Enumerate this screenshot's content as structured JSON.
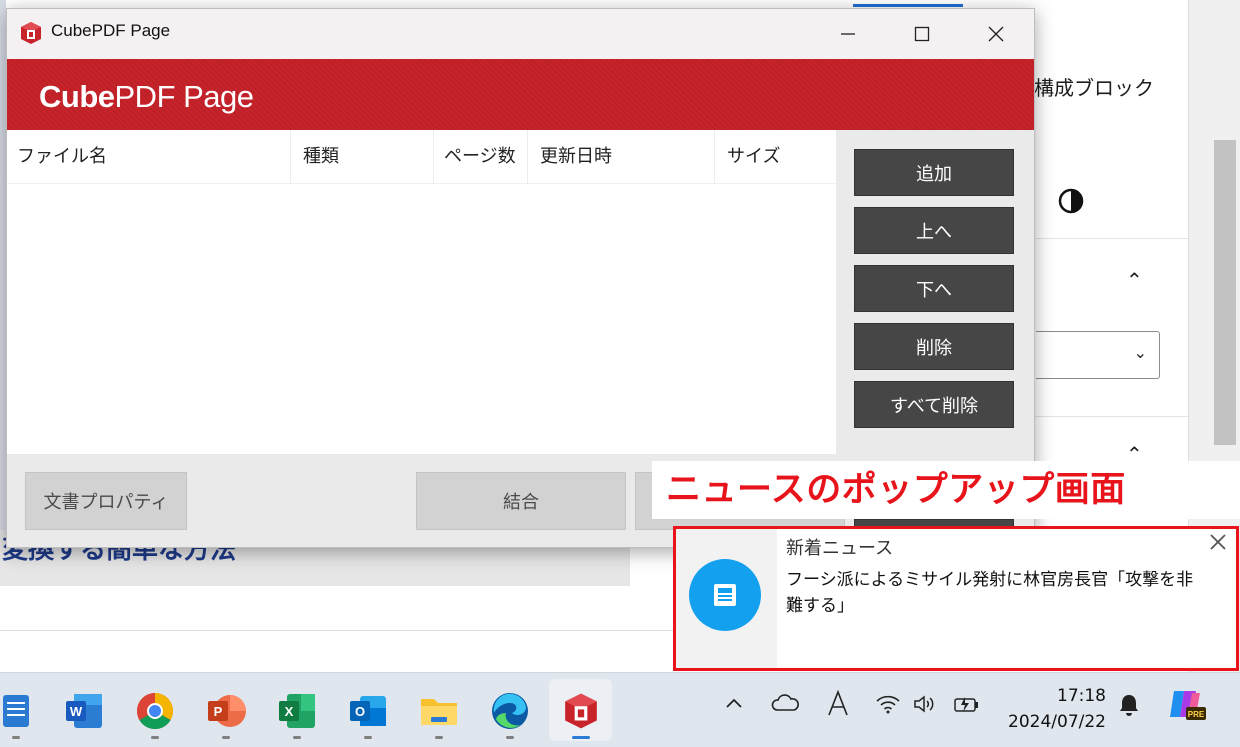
{
  "background": {
    "right_panel_text": "構成ブロック",
    "article_heading": "変換する簡単な方法"
  },
  "window": {
    "title": "CubePDF Page",
    "brand_bold": "Cube",
    "brand_light": "PDF Page",
    "columns": [
      "ファイル名",
      "種類",
      "ページ数",
      "更新日時",
      "サイズ"
    ],
    "buttons": {
      "add": "追加",
      "up": "上へ",
      "down": "下へ",
      "delete": "削除",
      "delete_all": "すべて削除"
    },
    "bottom_buttons": {
      "properties": "文書プロパティ",
      "merge": "結合"
    }
  },
  "annotation": {
    "label": "ニュースのポップアップ画面"
  },
  "news_toast": {
    "title": "新着ニュース",
    "body": "フーシ派によるミサイル発射に林官房長官「攻撃を非難する」"
  },
  "taskbar": {
    "time": "17:18",
    "date": "2024/07/22",
    "copilot_badge": "PRE",
    "apps": [
      "notepad",
      "word",
      "chrome",
      "powerpoint",
      "excel",
      "outlook",
      "file-explorer",
      "edge",
      "cubepdf-page"
    ],
    "colors": {
      "accent_red": "#c8232b",
      "toast_blue": "#12a0ef",
      "annotation_red": "#e8141b"
    }
  }
}
